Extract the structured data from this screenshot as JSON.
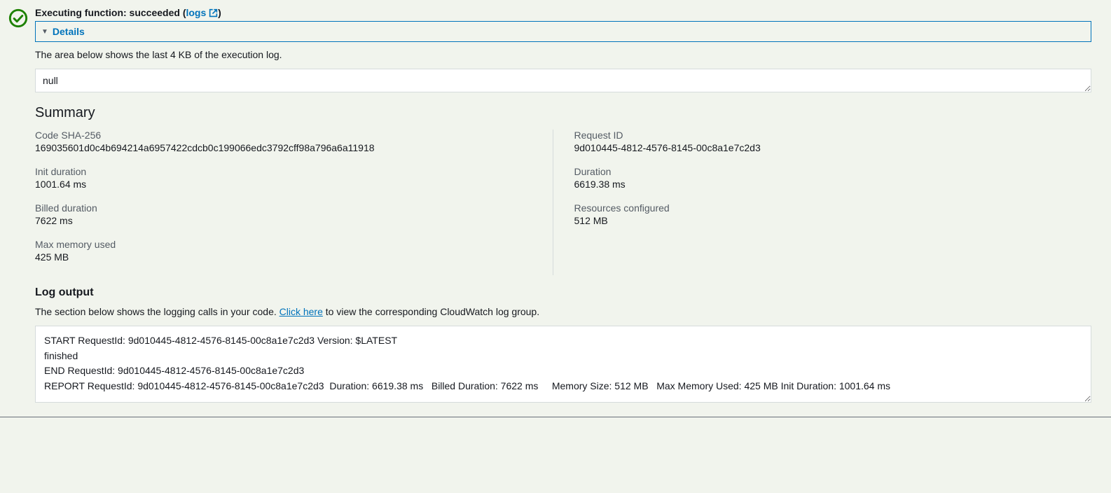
{
  "header": {
    "prefix": "Executing function: succeeded (",
    "logs_link": "logs",
    "suffix": ")"
  },
  "details": {
    "label": "Details"
  },
  "hint": "The area below shows the last 4 KB of the execution log.",
  "result": "null",
  "summary": {
    "title": "Summary",
    "left": [
      {
        "label": "Code SHA-256",
        "value": "169035601d0c4b694214a6957422cdcb0c199066edc3792cff98a796a6a11918"
      },
      {
        "label": "Init duration",
        "value": "1001.64 ms"
      },
      {
        "label": "Billed duration",
        "value": "7622 ms"
      },
      {
        "label": "Max memory used",
        "value": "425 MB"
      }
    ],
    "right": [
      {
        "label": "Request ID",
        "value": "9d010445-4812-4576-8145-00c8a1e7c2d3"
      },
      {
        "label": "Duration",
        "value": "6619.38 ms"
      },
      {
        "label": "Resources configured",
        "value": "512 MB"
      }
    ]
  },
  "log": {
    "header": "Log output",
    "hint_pre": "The section below shows the logging calls in your code. ",
    "hint_link": "Click here",
    "hint_post": " to view the corresponding CloudWatch log group.",
    "body": "START RequestId: 9d010445-4812-4576-8145-00c8a1e7c2d3 Version: $LATEST\nfinished\nEND RequestId: 9d010445-4812-4576-8145-00c8a1e7c2d3\nREPORT RequestId: 9d010445-4812-4576-8145-00c8a1e7c2d3  Duration: 6619.38 ms   Billed Duration: 7622 ms     Memory Size: 512 MB   Max Memory Used: 425 MB Init Duration: 1001.64 ms"
  }
}
